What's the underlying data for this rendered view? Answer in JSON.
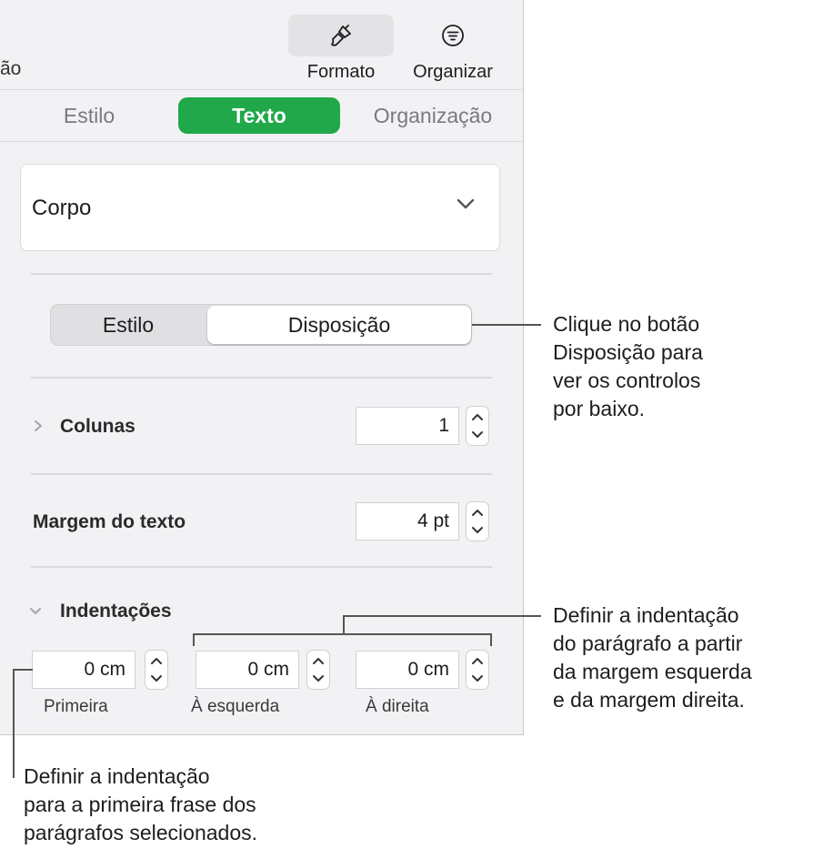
{
  "toolbar": {
    "partial_label": "ão",
    "formato_label": "Formato",
    "organizar_label": "Organizar"
  },
  "tabs": [
    {
      "label": "Estilo"
    },
    {
      "label": "Texto"
    },
    {
      "label": "Organização"
    }
  ],
  "paragraph_style": {
    "value": "Corpo"
  },
  "segment": {
    "left": "Estilo",
    "right": "Disposição"
  },
  "columns": {
    "label": "Colunas",
    "value": "1"
  },
  "text_inset": {
    "label": "Margem do texto",
    "value": "4 pt"
  },
  "indents": {
    "label": "Indentações",
    "fields": [
      {
        "value": "0 cm",
        "label": "Primeira"
      },
      {
        "value": "0 cm",
        "label": "À esquerda"
      },
      {
        "value": "0 cm",
        "label": "À direita"
      }
    ]
  },
  "callouts": {
    "disposicao": [
      "Clique no botão",
      "Disposição para",
      "ver os controlos",
      "por baixo."
    ],
    "paragraph": [
      "Definir a indentação",
      "do parágrafo a partir",
      "da margem esquerda",
      "e da margem direita."
    ],
    "first": [
      "Definir a indentação",
      "para a primeira frase dos",
      "parágrafos selecionados."
    ]
  },
  "colors": {
    "accent": "#20a84a",
    "panel": "#f2f2f4"
  },
  "icons": [
    "paintbrush-icon",
    "organize-icon",
    "chevron-down-icon",
    "disclosure-icon",
    "stepper-icon"
  ]
}
